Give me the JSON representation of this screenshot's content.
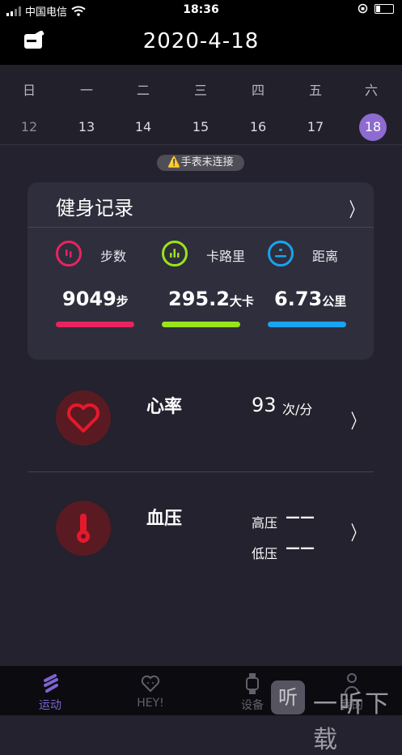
{
  "status": {
    "carrier": "中国电信",
    "time": "18:36"
  },
  "header": {
    "title": "2020-4-18"
  },
  "week": {
    "dows": [
      "日",
      "一",
      "二",
      "三",
      "四",
      "五",
      "六"
    ],
    "days": [
      "12",
      "13",
      "14",
      "15",
      "16",
      "17",
      "18"
    ],
    "selected_index": 6
  },
  "warning": "⚠️手表未连接",
  "fitness": {
    "title": "健身记录",
    "chevron": "〉",
    "stats": [
      {
        "label": "步数",
        "value": "9049",
        "unit": "步",
        "color": "#e8245f"
      },
      {
        "label": "卡路里",
        "value": "295.2",
        "unit": "大卡",
        "color": "#9ae41a"
      },
      {
        "label": "距离",
        "value": "6.73",
        "unit": "公里",
        "color": "#19a3f0"
      }
    ]
  },
  "heart_rate": {
    "name": "心率",
    "value": "93",
    "unit": "次/分",
    "chevron": "〉"
  },
  "blood_pressure": {
    "name": "血压",
    "high_label": "高压",
    "high_value": "——",
    "low_label": "低压",
    "low_value": "——",
    "chevron": "〉"
  },
  "tabs": [
    {
      "label": "运动",
      "icon": "sport-icon",
      "active": true
    },
    {
      "label": "HEY!",
      "icon": "heart-face-icon",
      "active": false
    },
    {
      "label": "设备",
      "icon": "watch-icon",
      "active": false
    },
    {
      "label": "我的",
      "icon": "person-icon",
      "active": false
    }
  ],
  "watermark": {
    "glyph": "听",
    "text": "一听下载"
  },
  "colors": {
    "accent": "#8d6bd1",
    "steps": "#e8245f",
    "calories": "#9ae41a",
    "distance": "#19a3f0",
    "heart": "#e5192b"
  }
}
